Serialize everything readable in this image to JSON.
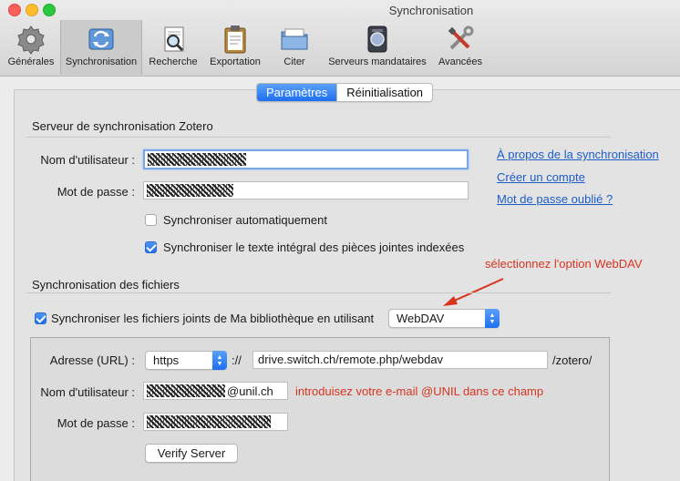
{
  "window": {
    "title": "Synchronisation"
  },
  "toolbar": {
    "items": [
      {
        "label": "Générales",
        "icon": "gear-icon"
      },
      {
        "label": "Synchronisation",
        "icon": "sync-icon"
      },
      {
        "label": "Recherche",
        "icon": "search-document-icon"
      },
      {
        "label": "Exportation",
        "icon": "clipboard-icon"
      },
      {
        "label": "Citer",
        "icon": "folder-icon"
      },
      {
        "label": "Serveurs mandataires",
        "icon": "server-icon"
      },
      {
        "label": "Avancées",
        "icon": "tools-icon"
      }
    ],
    "selected": "Synchronisation"
  },
  "tabs": [
    {
      "label": "Paramètres",
      "active": true
    },
    {
      "label": "Réinitialisation",
      "active": false
    }
  ],
  "zotero_server": {
    "title": "Serveur de synchronisation Zotero",
    "username_label": "Nom d'utilisateur :",
    "password_label": "Mot de passe :",
    "auto_sync_label": "Synchroniser automatiquement",
    "auto_sync_checked": false,
    "fulltext_label": "Synchroniser le texte intégral des pièces jointes indexées",
    "fulltext_checked": true,
    "links": {
      "about": "À propos de la synchronisation",
      "create_account": "Créer un compte",
      "forgot_password": "Mot de passe oublié ?"
    }
  },
  "file_sync": {
    "title": "Synchronisation des fichiers",
    "sync_label": "Synchroniser les fichiers joints de Ma bibliothèque en utilisant",
    "sync_checked": true,
    "method": "WebDAV",
    "annotation": "sélectionnez l'option WebDAV"
  },
  "webdav": {
    "address_label": "Adresse (URL) :",
    "protocol": "https",
    "separator": "://",
    "url": "drive.switch.ch/remote.php/webdav",
    "suffix": "/zotero/",
    "username_label": "Nom d'utilisateur :",
    "username_suffix": "@unil.ch",
    "username_annotation": "introduisez votre e-mail @UNIL dans ce champ",
    "password_label": "Mot de passe :",
    "verify_button": "Verify Server"
  },
  "colors": {
    "accent": "#1e6ff0",
    "link": "#1e5dc9",
    "annotation": "#d9331f"
  }
}
